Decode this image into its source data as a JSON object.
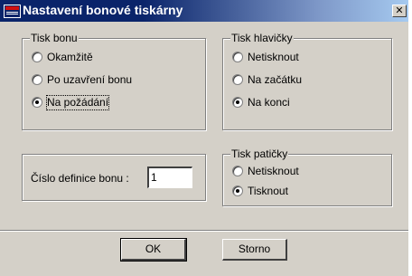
{
  "window": {
    "title": "Nastavení bonové tiskárny",
    "close_glyph": "✕"
  },
  "tisk_bonu": {
    "label": "Tisk bonu",
    "options": [
      {
        "label": "Okamžitě",
        "selected": false
      },
      {
        "label": "Po uzavření bonu",
        "selected": false
      },
      {
        "label": "Na požádání",
        "selected": true
      }
    ]
  },
  "tisk_hlavicky": {
    "label": "Tisk hlavičky",
    "options": [
      {
        "label": "Netisknout",
        "selected": false
      },
      {
        "label": "Na začátku",
        "selected": false
      },
      {
        "label": "Na konci",
        "selected": true
      }
    ]
  },
  "tisk_paticky": {
    "label": "Tisk patičky",
    "options": [
      {
        "label": "Netisknout",
        "selected": false
      },
      {
        "label": "Tisknout",
        "selected": true
      }
    ]
  },
  "cislo_definice": {
    "label": "Číslo definice bonu :",
    "value": "1"
  },
  "buttons": {
    "ok": "OK",
    "storno": "Storno"
  },
  "colors": {
    "face": "#d4d0c8",
    "title_active": "#0a246a",
    "title_gradient_end": "#a6caf0"
  }
}
